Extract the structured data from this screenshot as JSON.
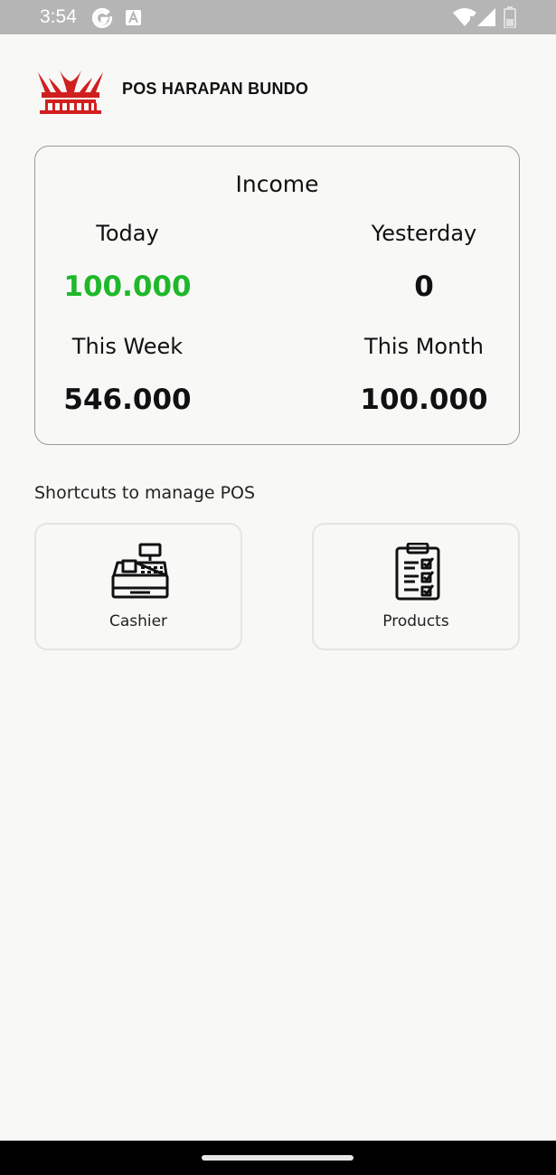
{
  "status_bar": {
    "time": "3:54",
    "icons": [
      "google-icon",
      "a-icon",
      "wifi-icon",
      "signal-icon",
      "battery-icon"
    ]
  },
  "header": {
    "brand": "POS HARAPAN BUNDO",
    "logo_icon": "rumah-gadang-logo",
    "logo_color": "#d11f1f"
  },
  "income": {
    "title": "Income",
    "today_label": "Today",
    "today_value": "100.000",
    "yesterday_label": "Yesterday",
    "yesterday_value": "0",
    "week_label": "This Week",
    "week_value": "546.000",
    "month_label": "This Month",
    "month_value": "100.000",
    "today_color": "#1eb82a"
  },
  "shortcuts": {
    "title": "Shortcuts to manage POS",
    "items": [
      {
        "label": "Cashier",
        "icon": "cash-register-icon"
      },
      {
        "label": "Products",
        "icon": "clipboard-checklist-icon"
      }
    ]
  }
}
